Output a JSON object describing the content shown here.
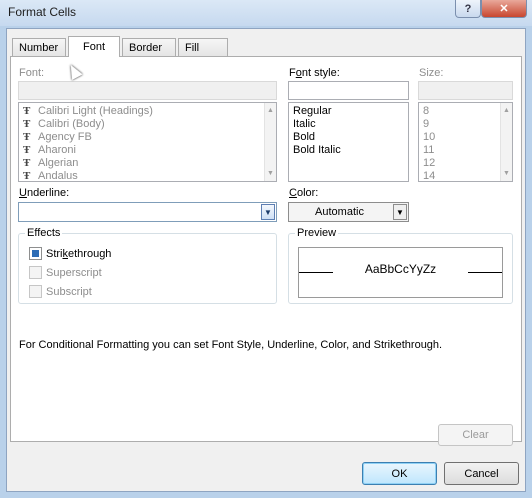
{
  "window": {
    "title": "Format Cells",
    "help_label": "?",
    "close_label": "✕"
  },
  "tabs": [
    {
      "label": "Number"
    },
    {
      "label": "Font"
    },
    {
      "label": "Border"
    },
    {
      "label": "Fill"
    }
  ],
  "font": {
    "label": "Font:",
    "value": "",
    "items": [
      "Calibri Light (Headings)",
      "Calibri (Body)",
      "Agency FB",
      "Aharoni",
      "Algerian",
      "Andalus"
    ]
  },
  "font_style": {
    "label_pre": "F",
    "label_ul": "o",
    "label_post": "nt style:",
    "value": "",
    "items": [
      "Regular",
      "Italic",
      "Bold",
      "Bold Italic"
    ]
  },
  "size": {
    "label": "Size:",
    "value": "",
    "items": [
      "8",
      "9",
      "10",
      "11",
      "12",
      "14"
    ]
  },
  "underline": {
    "label_ul": "U",
    "label_post": "nderline:",
    "value": ""
  },
  "color": {
    "label_ul": "C",
    "label_post": "olor:",
    "value": "Automatic"
  },
  "effects": {
    "title": "Effects",
    "strikethrough": {
      "pre": "Stri",
      "ul": "k",
      "post": "ethrough",
      "checked": true
    },
    "superscript": {
      "label": "Superscript",
      "checked": false
    },
    "subscript": {
      "label": "Subscript",
      "checked": false
    }
  },
  "preview": {
    "title": "Preview",
    "sample": "AaBbCcYyZz"
  },
  "info_text": "For Conditional Formatting you can set Font Style, Underline, Color, and Strikethrough.",
  "buttons": {
    "clear": "Clear",
    "ok": "OK",
    "cancel": "Cancel"
  }
}
